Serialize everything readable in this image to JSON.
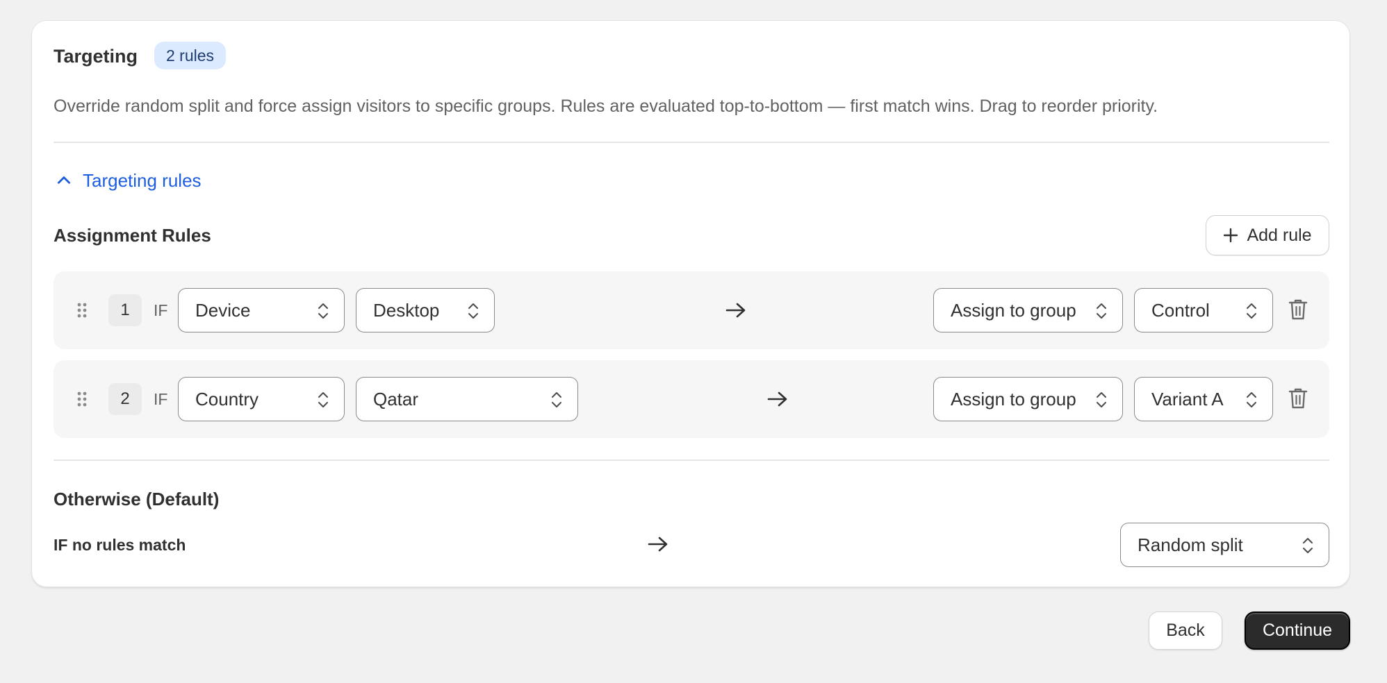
{
  "card": {
    "title": "Targeting",
    "badge": "2 rules",
    "description": "Override random split and force assign visitors to specific groups. Rules are evaluated top-to-bottom — first match wins. Drag to reorder priority.",
    "toggle_label": "Targeting rules",
    "toggle_icon": "chevron-up-icon"
  },
  "rules_section": {
    "title": "Assignment Rules",
    "add_rule_label": "Add rule",
    "rules": [
      {
        "number": "1",
        "if_label": "IF",
        "condition_field": "Device",
        "condition_value": "Desktop",
        "action": "Assign to group",
        "group": "Control"
      },
      {
        "number": "2",
        "if_label": "IF",
        "condition_field": "Country",
        "condition_value": "Qatar",
        "action": "Assign to group",
        "group": "Variant A"
      }
    ]
  },
  "default_section": {
    "title": "Otherwise (Default)",
    "condition_label": "IF no rules match",
    "default_value": "Random split"
  },
  "footer": {
    "back_label": "Back",
    "continue_label": "Continue"
  },
  "colors": {
    "link": "#1d5ee0",
    "badge_bg": "#dbeaff",
    "primary_button": "#2b2b2b",
    "page_bg": "#f1f1f1"
  }
}
